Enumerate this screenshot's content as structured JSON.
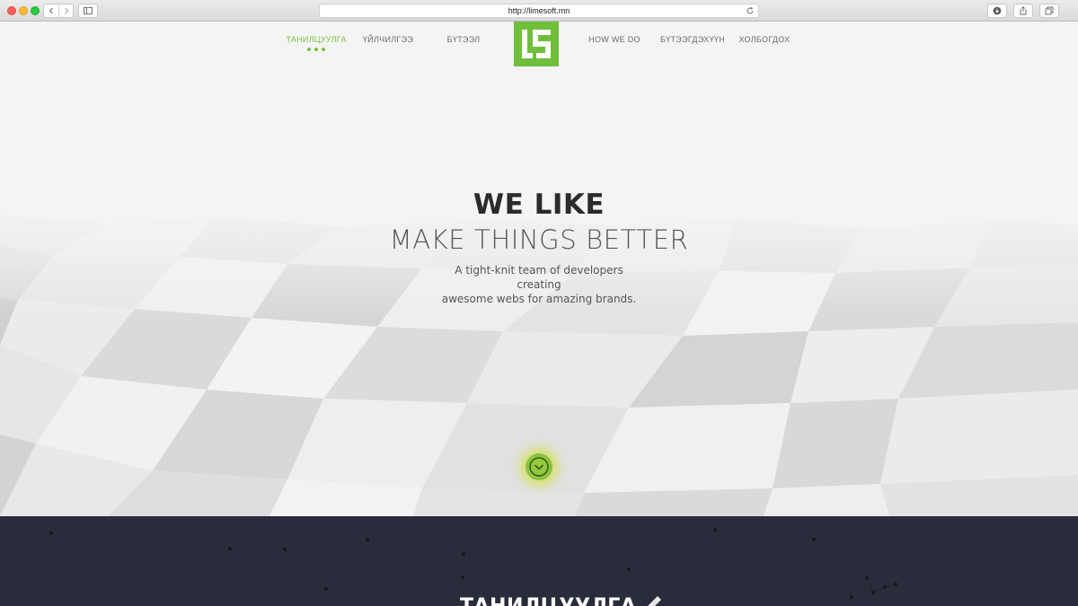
{
  "browser": {
    "url": "http://limesoft.mn",
    "new_tab_glyph": "+",
    "icons": [
      "back-icon",
      "forward-icon",
      "sidebar-icon",
      "reload-icon",
      "download-icon",
      "share-icon",
      "tabs-icon"
    ]
  },
  "nav": {
    "items": [
      {
        "label": "ТАНИЛЦУУЛГА",
        "active": true
      },
      {
        "label": "ҮЙЛЧИЛГЭЭ",
        "active": false
      },
      {
        "label": "БҮТЭЭЛ",
        "active": false
      },
      {
        "label": "HOW WE DO",
        "active": false
      },
      {
        "label": "БҮТЭЭГДЭХҮҮН",
        "active": false
      },
      {
        "label": "ХОЛБОГДОХ",
        "active": false
      }
    ],
    "accent_color": "#7bc142",
    "logo_color": "#6fbf3c"
  },
  "hero": {
    "headline": "WE LIKE",
    "subheadline": "MAKE THINGS BETTER",
    "tagline_line1": "A tight-knit team of developers creating",
    "tagline_line2": "awesome webs for amazing brands.",
    "scroll_icon": "chevron-down-icon"
  },
  "next_section": {
    "title": "ТАНИЛЦУУЛГА",
    "background": "#2b2c3b"
  }
}
